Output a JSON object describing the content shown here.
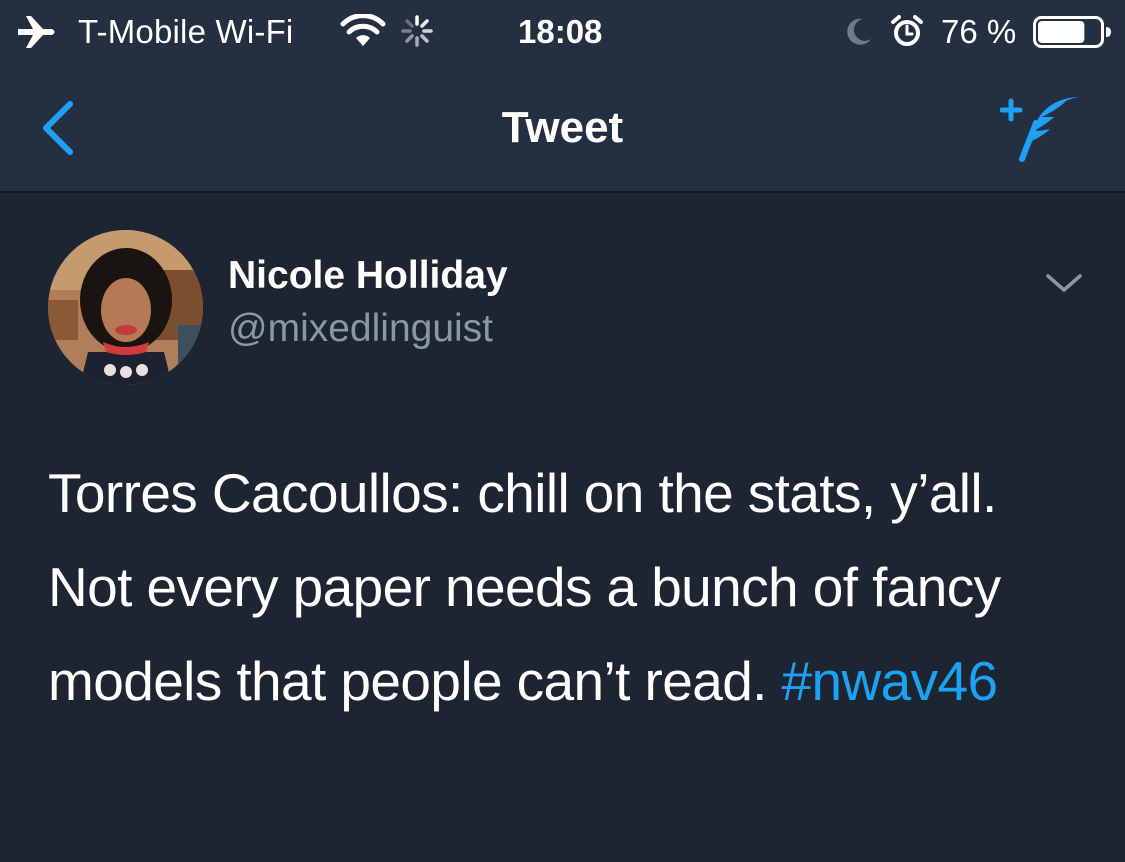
{
  "status_bar": {
    "carrier": "T-Mobile Wi-Fi",
    "time": "18:08",
    "battery_percent": "76 %",
    "battery_level": 0.76,
    "icons": [
      "airplane-icon",
      "wifi-icon",
      "loading-spinner-icon",
      "moon-icon",
      "alarm-icon",
      "battery-icon"
    ]
  },
  "nav": {
    "title": "Tweet",
    "back_icon": "chevron-left-icon",
    "compose_icon": "compose-tweet-icon"
  },
  "tweet": {
    "author_name": "Nicole Holliday",
    "author_handle": "@mixedlinguist",
    "text": "Torres Cacoullos: chill on the stats, y’all. Not every paper needs a bunch of fancy models that people can’t read. ",
    "hashtag": "#nwav46",
    "menu_icon": "chevron-down-icon"
  },
  "colors": {
    "background": "#1d2532",
    "bar": "#243042",
    "accent": "#1da1f2",
    "secondary_text": "#8899a6"
  }
}
